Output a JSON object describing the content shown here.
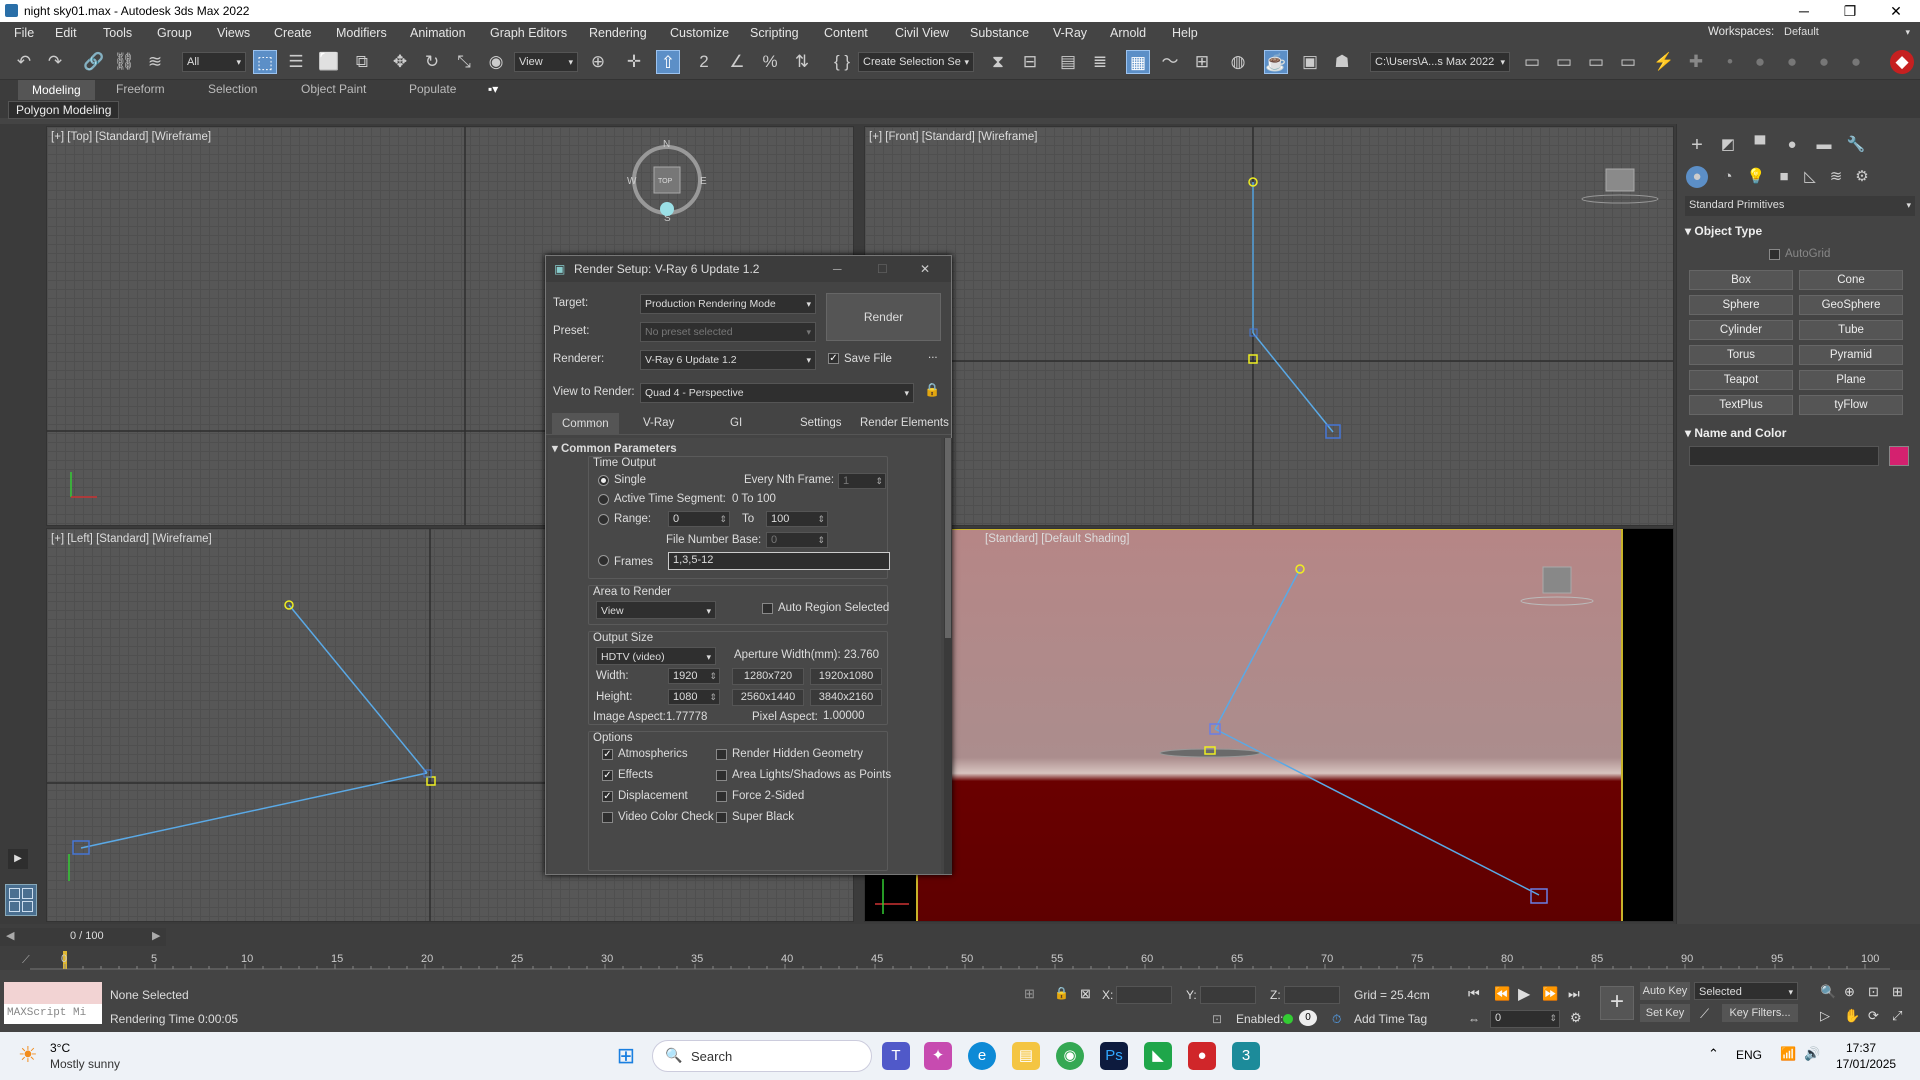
{
  "window": {
    "title": "night sky01.max - Autodesk 3ds Max 2022",
    "workspaces_label": "Workspaces:",
    "workspace_value": "Default"
  },
  "menu": [
    "File",
    "Edit",
    "Tools",
    "Group",
    "Views",
    "Create",
    "Modifiers",
    "Animation",
    "Graph Editors",
    "Rendering",
    "Customize",
    "Scripting",
    "Content",
    "Civil View",
    "Substance",
    "V-Ray",
    "Arnold",
    "Help"
  ],
  "toolbar": {
    "filter": "All",
    "coord": "View",
    "selection_set": "Create Selection Se",
    "project_path": "C:\\Users\\A...s Max 2022"
  },
  "ribbon": {
    "tabs": [
      "Modeling",
      "Freeform",
      "Selection",
      "Object Paint",
      "Populate"
    ],
    "sub": "Polygon Modeling"
  },
  "viewports": {
    "top": "[+] [Top] [Standard] [Wireframe]",
    "front": "[+] [Front] [Standard] [Wireframe]",
    "left": "[+] [Left] [Standard] [Wireframe]",
    "persp": "[Standard] [Default Shading]",
    "compass": {
      "n": "N",
      "s": "S",
      "w": "W",
      "e": "E",
      "center": "TOP"
    }
  },
  "render_setup": {
    "title": "Render Setup: V-Ray 6 Update 1.2",
    "target_label": "Target:",
    "target_value": "Production Rendering Mode",
    "preset_label": "Preset:",
    "preset_value": "No preset selected",
    "renderer_label": "Renderer:",
    "renderer_value": "V-Ray 6 Update 1.2",
    "save_file": "Save File",
    "more": "...",
    "view_label": "View to Render:",
    "view_value": "Quad 4 - Perspective",
    "render_button": "Render",
    "tabs": [
      "Common",
      "V-Ray",
      "GI",
      "Settings",
      "Render Elements"
    ],
    "rollout": "Common Parameters",
    "time_output": {
      "group": "Time Output",
      "single": "Single",
      "every_nth": "Every Nth Frame:",
      "every_nth_value": "1",
      "active_segment": "Active Time Segment:",
      "active_range": "0 To 100",
      "range": "Range:",
      "range_from": "0",
      "range_to_label": "To",
      "range_to": "100",
      "file_base_label": "File Number Base:",
      "file_base": "0",
      "frames": "Frames",
      "frames_value": "1,3,5-12"
    },
    "area": {
      "group": "Area to Render",
      "value": "View",
      "auto_region": "Auto Region Selected"
    },
    "output": {
      "group": "Output Size",
      "preset": "HDTV (video)",
      "aperture": "Aperture Width(mm): 23.760",
      "width_label": "Width:",
      "width": "1920",
      "height_label": "Height:",
      "height": "1080",
      "presets": [
        "1280x720",
        "1920x1080",
        "2560x1440",
        "3840x2160"
      ],
      "image_aspect": "Image Aspect:1.77778",
      "pixel_aspect_label": "Pixel Aspect:",
      "pixel_aspect": "1.00000"
    },
    "options": {
      "group": "Options",
      "left": [
        {
          "label": "Atmospherics",
          "checked": true
        },
        {
          "label": "Effects",
          "checked": true
        },
        {
          "label": "Displacement",
          "checked": true
        },
        {
          "label": "Video Color Check",
          "checked": false
        }
      ],
      "right": [
        {
          "label": "Render Hidden Geometry",
          "checked": false
        },
        {
          "label": "Area Lights/Shadows as Points",
          "checked": false
        },
        {
          "label": "Force 2-Sided",
          "checked": false
        },
        {
          "label": "Super Black",
          "checked": false
        }
      ]
    }
  },
  "command_panel": {
    "category": "Standard Primitives",
    "object_type": "Object Type",
    "autogrid": "AutoGrid",
    "buttons": [
      "Box",
      "Cone",
      "Sphere",
      "GeoSphere",
      "Cylinder",
      "Tube",
      "Torus",
      "Pyramid",
      "Teapot",
      "Plane",
      "TextPlus",
      "tyFlow"
    ],
    "name_color": "Name and Color",
    "swatch": "#d4216f"
  },
  "timeline": {
    "frame": "0 / 100",
    "ticks": [
      "0",
      "5",
      "10",
      "15",
      "20",
      "25",
      "30",
      "35",
      "40",
      "45",
      "50",
      "55",
      "60",
      "65",
      "70",
      "75",
      "80",
      "85",
      "90",
      "95",
      "100"
    ]
  },
  "status": {
    "selection": "None Selected",
    "render_time": "Rendering Time 0:00:05",
    "maxscript": "MAXScript Mi",
    "x_label": "X:",
    "y_label": "Y:",
    "z_label": "Z:",
    "grid": "Grid = 25.4cm",
    "enabled": "Enabled:",
    "add_time_tag": "Add Time Tag",
    "auto_key": "Auto Key",
    "set_key": "Set Key",
    "selected": "Selected",
    "key_filters": "Key Filters...",
    "frame_value": "0"
  },
  "taskbar": {
    "temp": "3°C",
    "weather": "Mostly sunny",
    "search": "Search",
    "lang": "ENG",
    "time": "17:37",
    "date": "17/01/2025"
  }
}
